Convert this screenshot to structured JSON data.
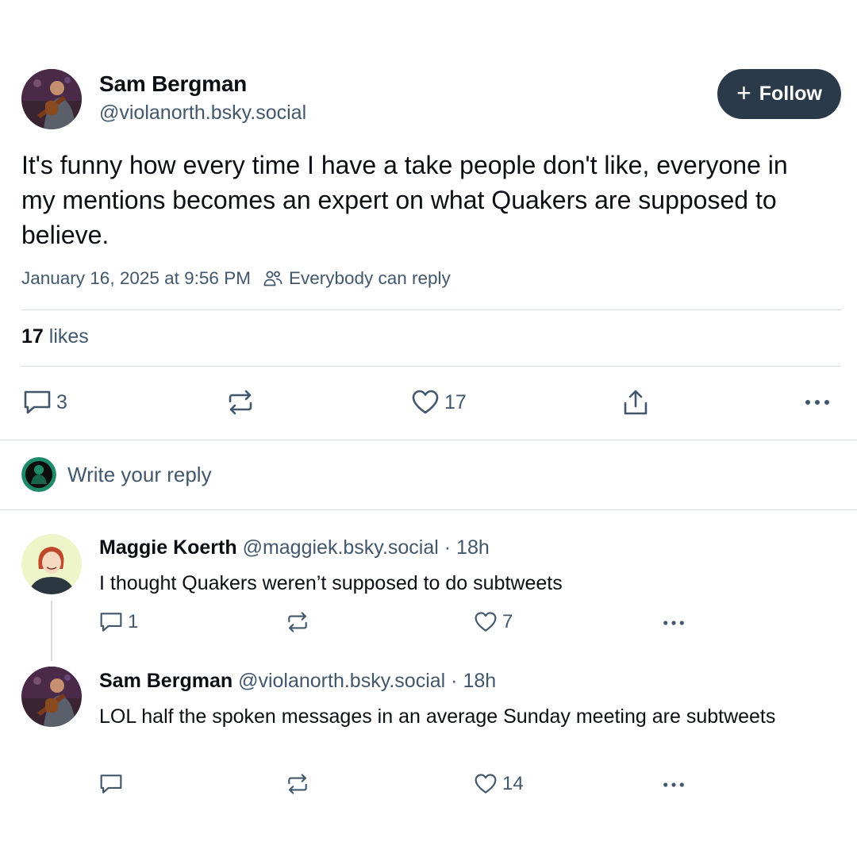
{
  "post": {
    "author_name": "Sam Bergman",
    "author_handle": "@violanorth.bsky.social",
    "follow_label": "Follow",
    "text": "It's funny how every time I have a take people don't like, everyone in my mentions becomes an expert on what Quakers are supposed to believe.",
    "timestamp": "January 16, 2025 at 9:56 PM",
    "reply_setting": "Everybody can reply",
    "likes_count": "17",
    "likes_label": "likes",
    "actions": {
      "reply_count": "3",
      "repost_count": "",
      "like_count": "17"
    }
  },
  "composer": {
    "placeholder": "Write your reply"
  },
  "replies": [
    {
      "author_name": "Maggie Koerth",
      "author_handle": "@maggiek.bsky.social",
      "age": "· 18h",
      "text": "I thought Quakers weren’t supposed to do subtweets",
      "reply_count": "1",
      "like_count": "7"
    },
    {
      "author_name": "Sam Bergman",
      "author_handle": "@violanorth.bsky.social",
      "age": "· 18h",
      "text": "LOL half the spoken messages in an average Sunday meeting are subtweets",
      "reply_count": "",
      "like_count": "14"
    }
  ],
  "colors": {
    "text_primary": "#0b0f14",
    "text_muted": "#42576c",
    "follow_bg": "#2b3a4a",
    "divider": "#d4dbe2"
  },
  "icons": [
    "reply-icon",
    "repost-icon",
    "heart-icon",
    "share-icon",
    "more-icon",
    "people-icon",
    "plus-icon"
  ]
}
